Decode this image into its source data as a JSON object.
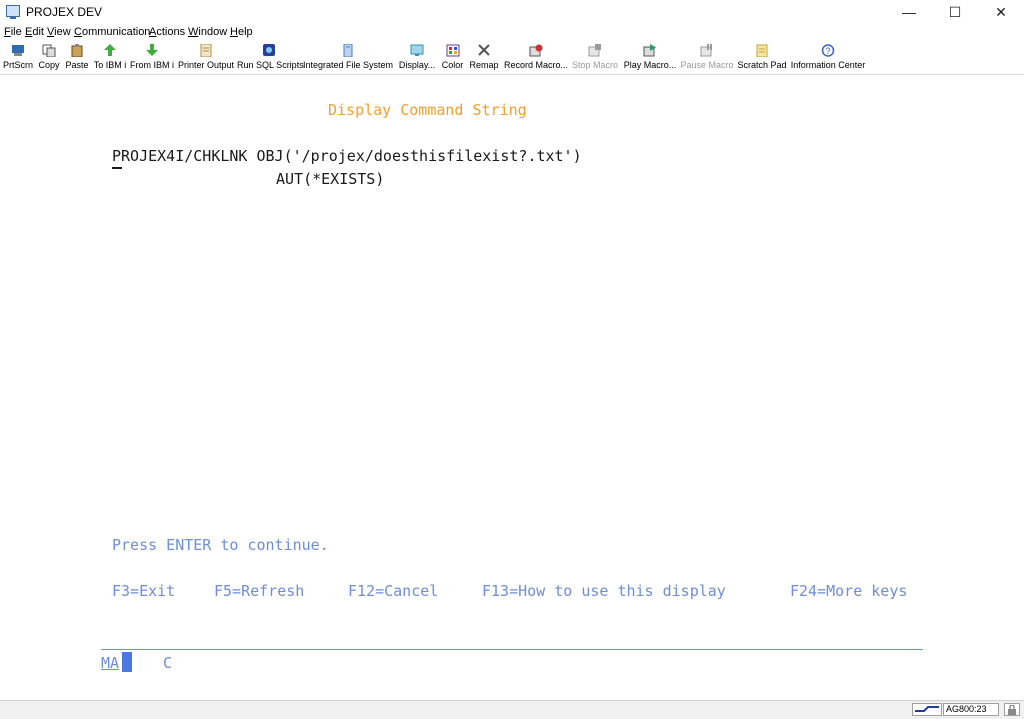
{
  "window": {
    "title": "PROJEX DEV",
    "minimize_glyph": "—",
    "maximize_glyph": "☐",
    "close_glyph": "✕"
  },
  "menu": [
    {
      "ul": "F",
      "rest": "ile"
    },
    {
      "ul": "E",
      "rest": "dit"
    },
    {
      "ul": "V",
      "rest": "iew"
    },
    {
      "ul": "C",
      "rest": "ommunication"
    },
    {
      "ul": "A",
      "rest": "ctions"
    },
    {
      "ul": "W",
      "rest": "indow"
    },
    {
      "ul": "H",
      "rest": "elp"
    }
  ],
  "toolbar": [
    {
      "label": "PrtScrn",
      "icon": "printer-screen-icon",
      "color": "#2f6db3",
      "enabled": true
    },
    {
      "label": "Copy",
      "icon": "copy-icon",
      "color": "#555555",
      "enabled": true
    },
    {
      "label": "Paste",
      "icon": "paste-icon",
      "color": "#8a6a2a",
      "enabled": true
    },
    {
      "label": "To IBM i",
      "icon": "upload-arrow-icon",
      "color": "#3fae3f",
      "enabled": true
    },
    {
      "label": "From IBM i",
      "icon": "download-arrow-icon",
      "color": "#3fae3f",
      "enabled": true
    },
    {
      "label": "Printer Output",
      "icon": "printer-output-icon",
      "color": "#b08a4a",
      "enabled": true
    },
    {
      "label": "Run SQL Scripts",
      "icon": "sql-scripts-icon",
      "color": "#2a3f9a",
      "enabled": true
    },
    {
      "label": "Integrated File System",
      "icon": "file-system-icon",
      "color": "#4a7fc0",
      "enabled": true
    },
    {
      "label": "Display...",
      "icon": "display-icon",
      "color": "#3a8fb0",
      "enabled": true
    },
    {
      "label": "Color",
      "icon": "color-palette-icon",
      "color": "#6a3aa0",
      "enabled": true
    },
    {
      "label": "Remap",
      "icon": "remap-keyboard-icon",
      "color": "#555555",
      "enabled": true
    },
    {
      "label": "Record Macro...",
      "icon": "record-macro-icon",
      "color": "#d03030",
      "enabled": true
    },
    {
      "label": "Stop Macro",
      "icon": "stop-macro-icon",
      "color": "#9a9a9a",
      "enabled": false
    },
    {
      "label": "Play Macro...",
      "icon": "play-macro-icon",
      "color": "#2a9a6a",
      "enabled": true
    },
    {
      "label": "Pause Macro",
      "icon": "pause-macro-icon",
      "color": "#9a9a9a",
      "enabled": false
    },
    {
      "label": "Scratch Pad",
      "icon": "scratch-pad-icon",
      "color": "#c0a040",
      "enabled": true
    },
    {
      "label": "Information Center",
      "icon": "information-center-icon",
      "color": "#3a5fd0",
      "enabled": true
    }
  ],
  "terminal": {
    "screen_title": "Display Command String",
    "command_line1": "PROJEX4I/CHKLNK OBJ('/projex/doesthisfilexist?.txt')",
    "command_line2": "AUT(*EXISTS)",
    "prompt": "Press ENTER to continue.",
    "function_keys": [
      "F3=Exit",
      "F5=Refresh",
      "F12=Cancel",
      "F13=How to use this display",
      "F24=More keys"
    ],
    "status_left": "MA",
    "status_mid": "C"
  },
  "statusbar": {
    "session_position": "AG800:23",
    "colors": {
      "accent": "#1f3fa0"
    }
  }
}
